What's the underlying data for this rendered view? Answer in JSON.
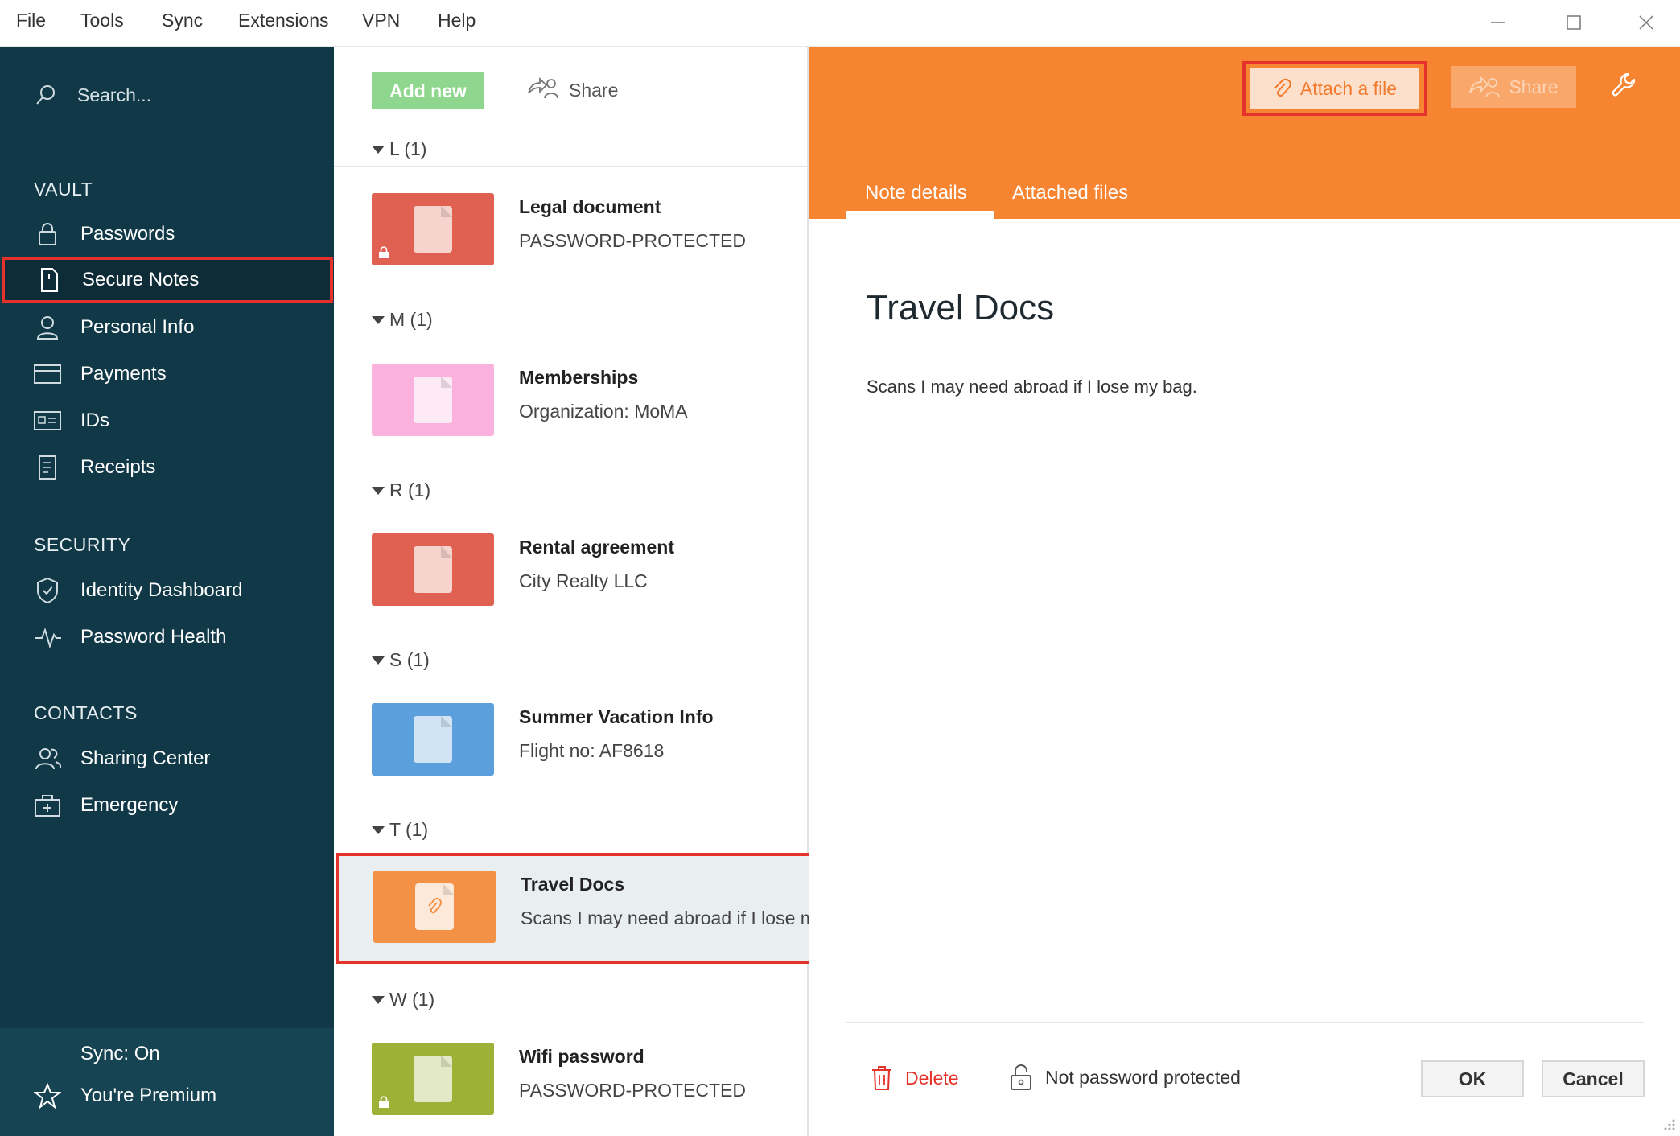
{
  "menu": [
    "File",
    "Tools",
    "Sync",
    "Extensions",
    "VPN",
    "Help"
  ],
  "sidebar": {
    "search_placeholder": "Search...",
    "sections": {
      "vault": "VAULT",
      "security": "SECURITY",
      "contacts": "CONTACTS"
    },
    "items": [
      {
        "label": "Passwords",
        "icon": "lock-icon"
      },
      {
        "label": "Secure Notes",
        "icon": "note-icon",
        "active": true
      },
      {
        "label": "Personal Info",
        "icon": "person-icon"
      },
      {
        "label": "Payments",
        "icon": "card-icon"
      },
      {
        "label": "IDs",
        "icon": "id-icon"
      },
      {
        "label": "Receipts",
        "icon": "receipt-icon"
      },
      {
        "label": "Identity Dashboard",
        "icon": "shield-icon"
      },
      {
        "label": "Password Health",
        "icon": "pulse-icon"
      },
      {
        "label": "Sharing Center",
        "icon": "people-icon"
      },
      {
        "label": "Emergency",
        "icon": "first-aid-icon"
      }
    ],
    "footer": {
      "sync": "Sync: On",
      "premium": "You're Premium"
    }
  },
  "list": {
    "add_new": "Add new",
    "share": "Share",
    "groups": [
      {
        "header": "L (1)",
        "title": "Legal document",
        "subtitle": "PASSWORD-PROTECTED",
        "color": "#e06151",
        "locked": true
      },
      {
        "header": "M (1)",
        "title": "Memberships",
        "subtitle": "Organization: MoMA",
        "color": "#fbb1dd",
        "locked": false
      },
      {
        "header": "R (1)",
        "title": "Rental agreement",
        "subtitle": "City Realty LLC",
        "color": "#e06151",
        "locked": false
      },
      {
        "header": "S (1)",
        "title": "Summer Vacation Info",
        "subtitle": "Flight no: AF8618",
        "color": "#5b9fdc",
        "locked": false
      },
      {
        "header": "T (1)",
        "title": "Travel Docs",
        "subtitle": "Scans I may need abroad if I lose my bag.",
        "color": "#f39147",
        "locked": false,
        "selected": true
      },
      {
        "header": "W (1)",
        "title": "Wifi password",
        "subtitle": "PASSWORD-PROTECTED",
        "color": "#9cb135",
        "locked": true
      }
    ]
  },
  "detail": {
    "attach_label": "Attach a file",
    "share_label": "Share",
    "tabs": [
      "Note details",
      "Attached files"
    ],
    "title": "Travel Docs",
    "body": "Scans I may need abroad if I lose my bag.",
    "delete_label": "Delete",
    "password_status": "Not password protected",
    "ok_label": "OK",
    "cancel_label": "Cancel",
    "accent_color": "#f78431"
  }
}
